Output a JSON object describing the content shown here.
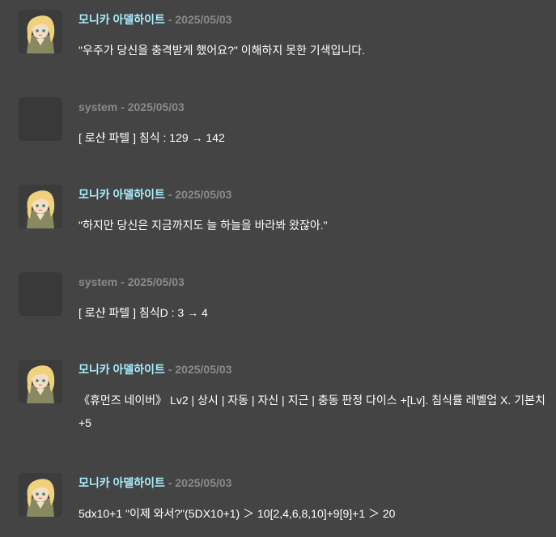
{
  "messages": [
    {
      "author": "모니카 아델하이트",
      "separator": " - ",
      "date": "2025/05/03",
      "text": "\"우주가 당신을 충격받게 했어요?\" 이해하지 못한 기색입니다.",
      "avatar": "monika-portrait"
    },
    {
      "author": "system",
      "separator": " - ",
      "date": "2025/05/03",
      "text": "[ 로샨 파텔 ] 침식 : 129 → 142",
      "avatar": "none"
    },
    {
      "author": "모니카 아델하이트",
      "separator": " - ",
      "date": "2025/05/03",
      "text": "\"하지만 당신은 지금까지도 늘 하늘을 바라봐 왔잖아.\"",
      "avatar": "monika-portrait"
    },
    {
      "author": "system",
      "separator": " - ",
      "date": "2025/05/03",
      "text": "[ 로샨 파텔 ] 침식D : 3 → 4",
      "avatar": "none"
    },
    {
      "author": "모니카 아델하이트",
      "separator": " - ",
      "date": "2025/05/03",
      "text": "《휴먼즈 네이버》 Lv2 | 상시 | 자동 | 자신 | 지근 | 충동 판정 다이스 +[Lv]. 침식률 레벨업 X. 기본치 +5",
      "avatar": "monika-portrait"
    },
    {
      "author": "모니카 아델하이트",
      "separator": " - ",
      "date": "2025/05/03",
      "text": "5dx10+1 \"이제 와서?\"(5DX10+1) ＞ 10[2,4,6,8,10]+9[9]+1 ＞ 20",
      "avatar": "monika-portrait"
    }
  ],
  "colors": {
    "background": "#444444",
    "author": "#a8eefd",
    "meta": "#8a8a8a",
    "text": "#ffffff"
  }
}
